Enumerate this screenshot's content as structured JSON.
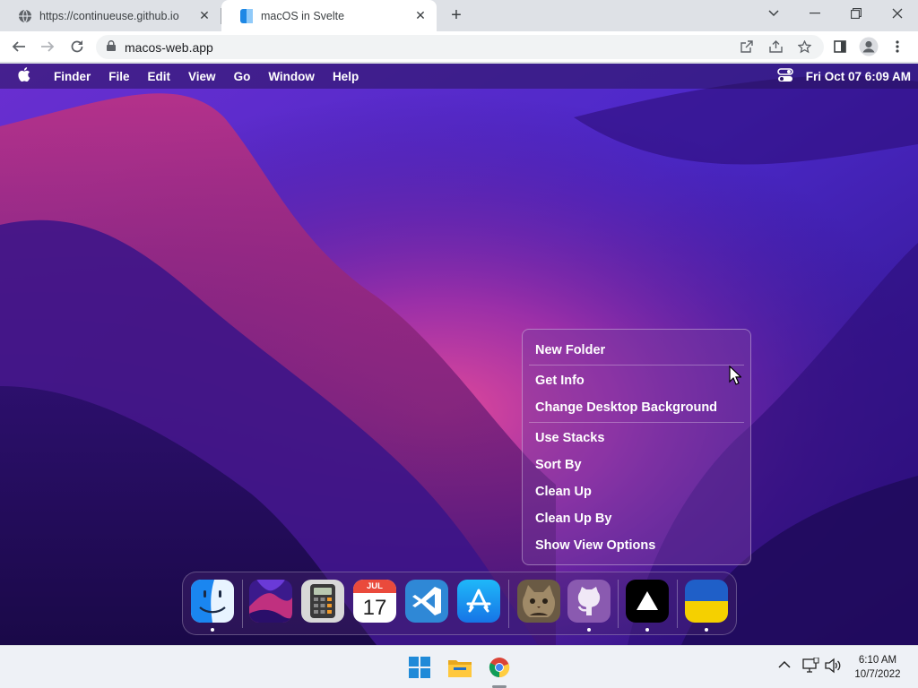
{
  "browser": {
    "tabs": [
      {
        "title": "https://continueuse.github.io",
        "favicon": "globe-icon"
      },
      {
        "title": "macOS in Svelte",
        "favicon": "finder-icon",
        "active": true
      }
    ],
    "url": "macos-web.app",
    "new_tab_symbol": "+"
  },
  "menubar": {
    "app_name": "Finder",
    "items": [
      "File",
      "Edit",
      "View",
      "Go",
      "Window",
      "Help"
    ],
    "clock": "Fri Oct 07  6:09 AM"
  },
  "context_menu": {
    "groups": [
      [
        "New Folder"
      ],
      [
        "Get Info",
        "Change Desktop Background"
      ],
      [
        "Use Stacks",
        "Sort By",
        "Clean Up",
        "Clean Up By",
        "Show View Options"
      ]
    ]
  },
  "dock": {
    "apps": [
      {
        "name": "Finder",
        "icon": "finder-icon",
        "running": true
      },
      {
        "name": "Wallpapers",
        "icon": "wallpapers-icon",
        "running": false
      },
      {
        "name": "Calculator",
        "icon": "calculator-icon",
        "running": false
      },
      {
        "name": "Calendar",
        "icon": "calendar-icon",
        "running": false,
        "month": "JUL",
        "day": "17"
      },
      {
        "name": "VS Code",
        "icon": "vscode-icon",
        "running": false
      },
      {
        "name": "App Store",
        "icon": "app-store-icon",
        "running": false
      },
      {
        "name": "Cat",
        "icon": "cat-icon",
        "running": false
      },
      {
        "name": "GitHub",
        "icon": "github-icon",
        "running": true
      },
      {
        "name": "Vercel",
        "icon": "vercel-icon",
        "running": true
      },
      {
        "name": "Ukraine",
        "icon": "ukraine-flag-icon",
        "running": true
      }
    ]
  },
  "taskbar": {
    "time": "6:10 AM",
    "date": "10/7/2022",
    "pinned": [
      "windows-start-icon",
      "file-explorer-icon",
      "chrome-icon"
    ]
  },
  "colors": {
    "wallpaper_deep": "#2a0c6e",
    "wallpaper_magenta": "#b8328a",
    "wallpaper_violet": "#5a2fd6"
  }
}
